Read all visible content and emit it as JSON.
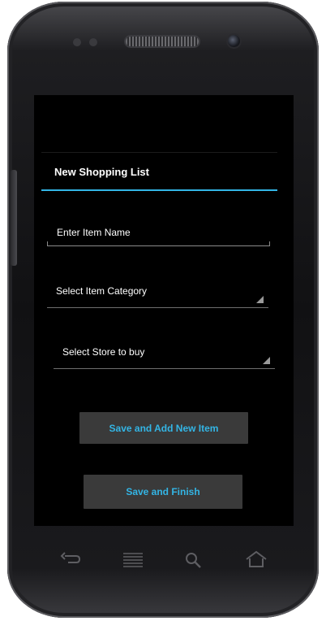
{
  "app": {
    "title": "New Shopping List"
  },
  "form": {
    "item_name_placeholder": "Enter Item Name",
    "category_spinner_label": "Select Item Category",
    "store_spinner_label": "Select Store to buy"
  },
  "buttons": {
    "save_add_label": "Save and Add New Item",
    "save_finish_label": "Save and Finish"
  },
  "nav_keys": [
    "back-icon",
    "menu-icon",
    "search-icon",
    "home-icon"
  ],
  "colors": {
    "accent": "#33b5e5",
    "screen_background": "#000000",
    "button_background": "#3a3a3a"
  }
}
